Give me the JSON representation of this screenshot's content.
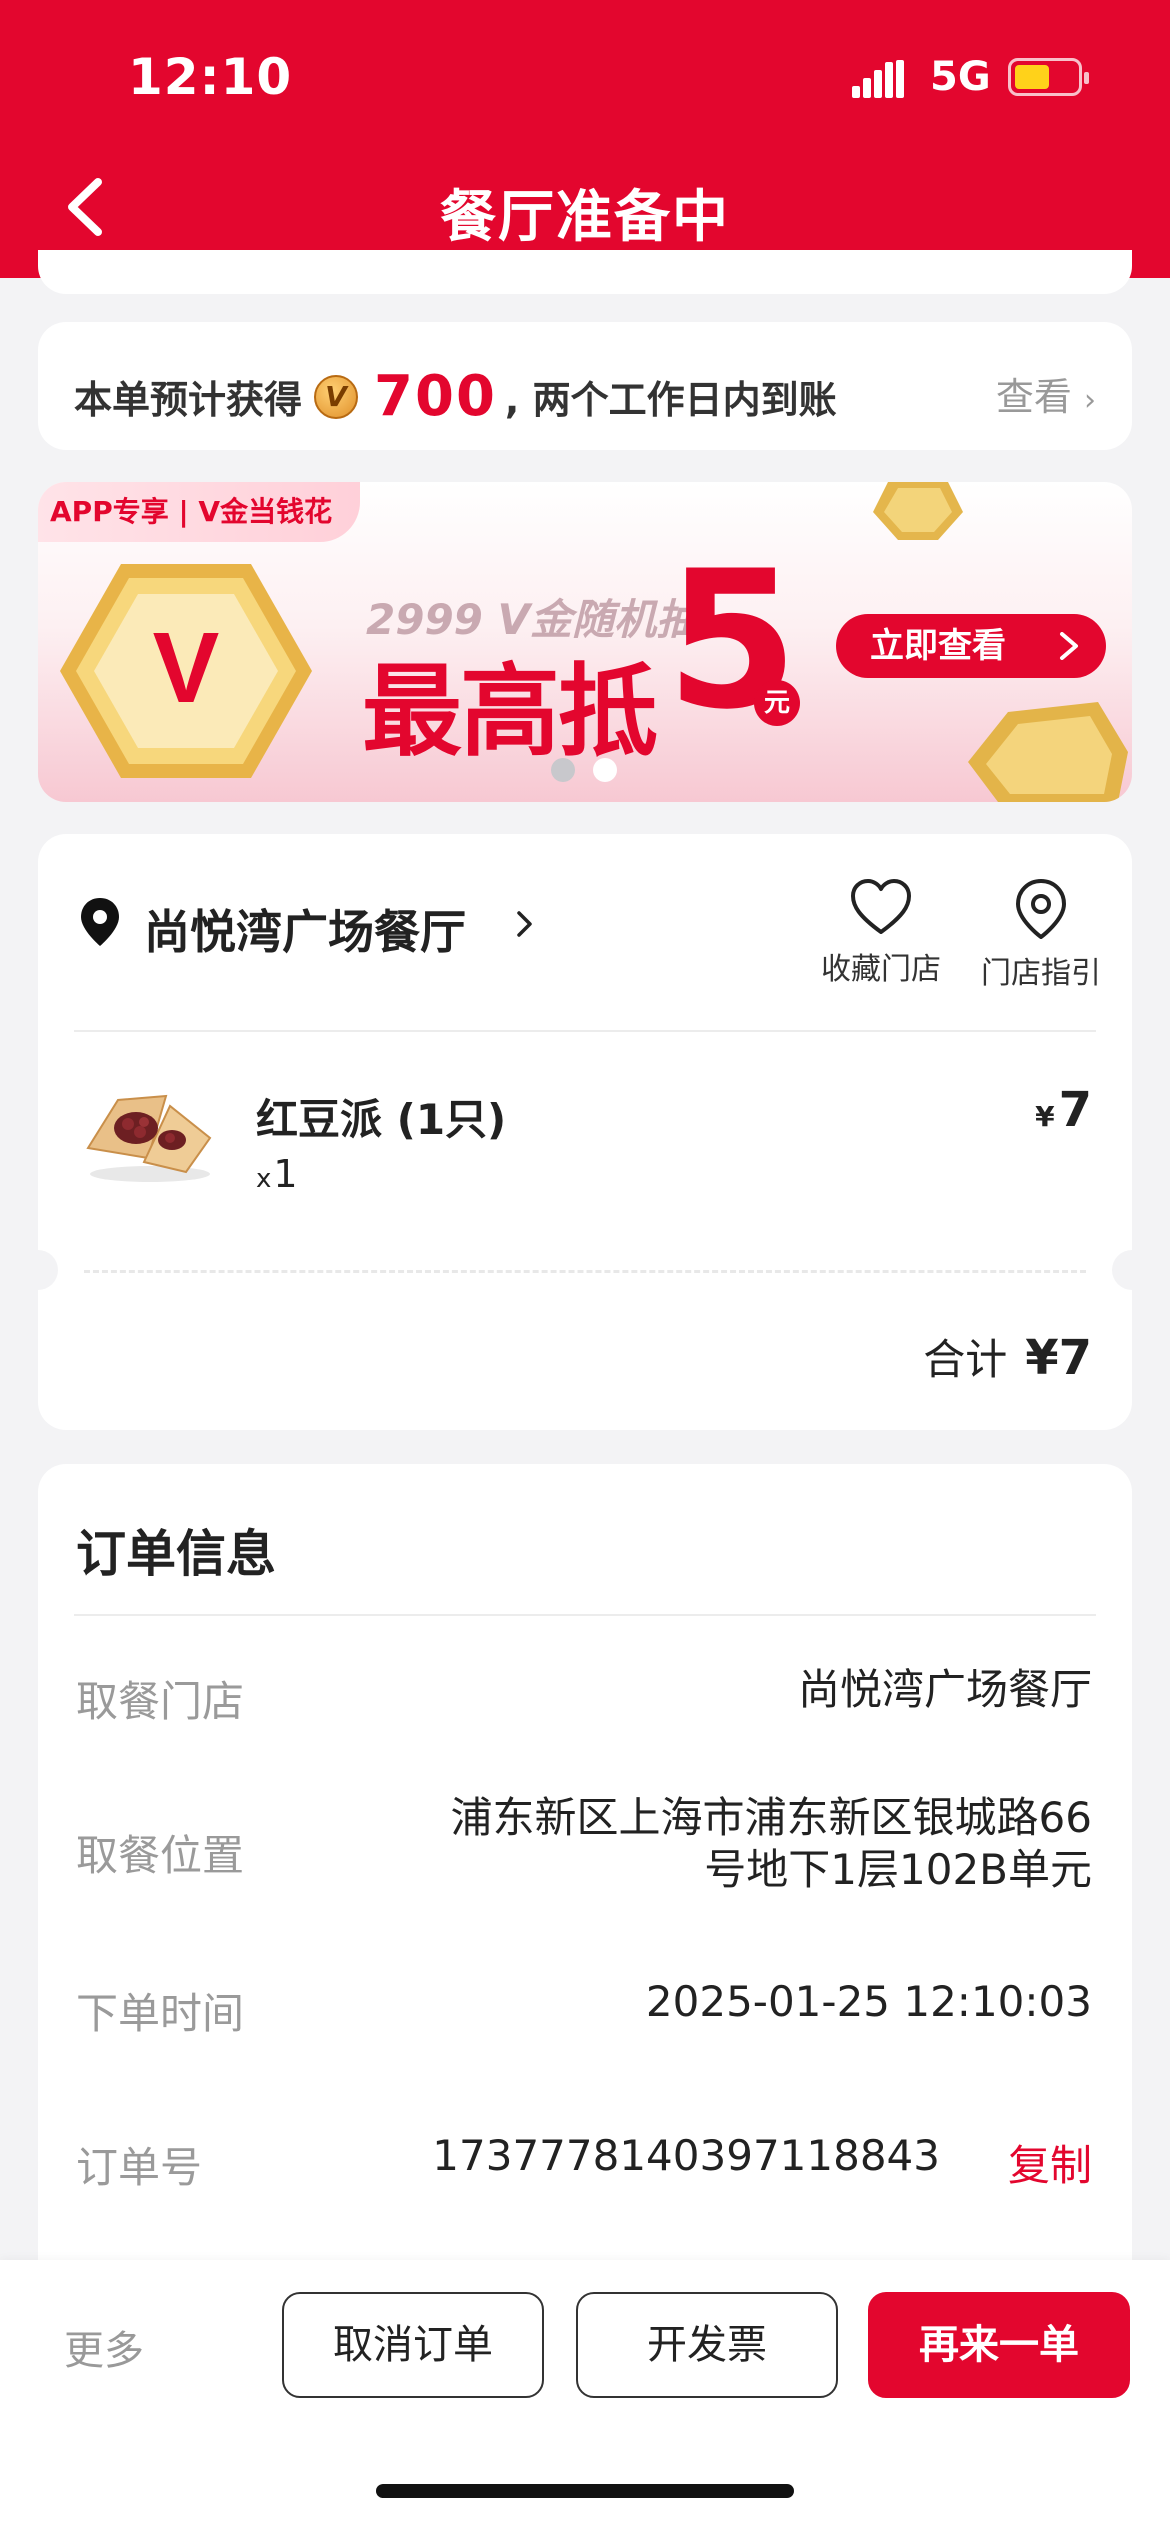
{
  "status_bar": {
    "time": "12:10",
    "network": "5G"
  },
  "header": {
    "title": "餐厅准备中",
    "back_icon": "chevron-left-icon"
  },
  "points": {
    "prefix": "本单预计获得",
    "coin_letter": "V",
    "value": "700",
    "suffix": ", 两个工作日内到账",
    "view_label": "查看"
  },
  "banner": {
    "tag": "APP专享 | V金当钱花",
    "badge_letter": "V",
    "subtitle": "2999 V金随机抽",
    "headline": "最高抵",
    "amount": "5",
    "unit": "元",
    "cta": "立即查看",
    "active_slide": 2,
    "slides": 2
  },
  "store": {
    "name": "尚悦湾广场餐厅",
    "actions": [
      {
        "label": "收藏门店",
        "icon": "heart-icon"
      },
      {
        "label": "门店指引",
        "icon": "location-pin-icon"
      }
    ]
  },
  "items": [
    {
      "name": "红豆派 (1只)",
      "qty_prefix": "x",
      "qty": "1",
      "currency": "¥",
      "price": "7"
    }
  ],
  "total": {
    "label": "合计",
    "value": "¥7"
  },
  "order_info": {
    "title": "订单信息",
    "rows": [
      {
        "label": "取餐门店",
        "value": "尚悦湾广场餐厅"
      },
      {
        "label": "取餐位置",
        "value_line1": "浦东新区上海市浦东新区银城路66",
        "value_line2": "号地下1层102B单元"
      },
      {
        "label": "下单时间",
        "value": "2025-01-25 12:10:03"
      },
      {
        "label": "订单号",
        "value": "1737778140397118843",
        "action": "复制"
      }
    ]
  },
  "bottom_bar": {
    "more": "更多",
    "cancel": "取消订单",
    "invoice": "开发票",
    "reorder": "再来一单"
  },
  "colors": {
    "brand_red": "#e3062e",
    "background": "#f3f3f5",
    "muted_text": "#9a9a9a"
  }
}
